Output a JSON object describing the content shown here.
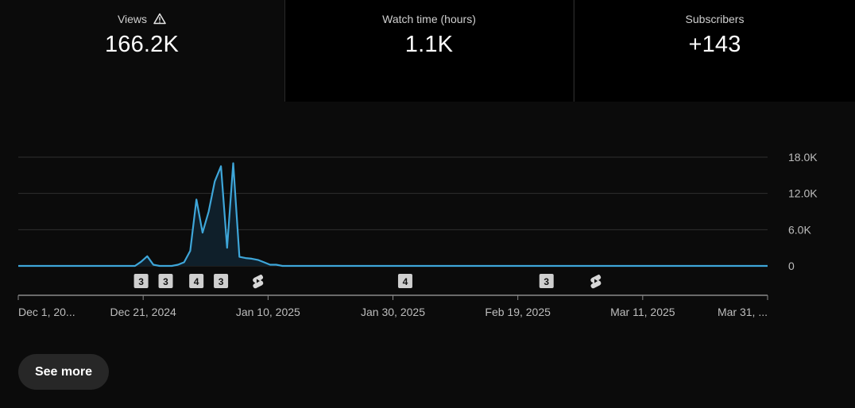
{
  "metrics": [
    {
      "label": "Views",
      "value": "166.2K",
      "warning_icon": "warning-triangle-icon"
    },
    {
      "label": "Watch time (hours)",
      "value": "1.1K"
    },
    {
      "label": "Subscribers",
      "value": "+143"
    }
  ],
  "chart_data": {
    "type": "area",
    "series": [
      {
        "values": [
          0,
          0,
          0,
          0,
          0,
          0,
          0,
          0,
          0,
          0,
          0,
          0,
          0,
          0,
          0,
          0,
          0,
          0,
          0,
          0,
          700,
          1600,
          200,
          0,
          0,
          0,
          200,
          600,
          2500,
          11000,
          5500,
          9000,
          14000,
          16500,
          3000,
          17000,
          1500,
          1300,
          1200,
          1000,
          600,
          200,
          200,
          0,
          0,
          0,
          0,
          0,
          0,
          0,
          0,
          0,
          0,
          0,
          0,
          0,
          0,
          0,
          0,
          0,
          0,
          0,
          0,
          0,
          0,
          0,
          0,
          0,
          0,
          0,
          0,
          0,
          0,
          0,
          0,
          0,
          0,
          0,
          0,
          0,
          0,
          0,
          0,
          0,
          0,
          0,
          0,
          0,
          0,
          0,
          0,
          0,
          0,
          0,
          0,
          0,
          0,
          0,
          0,
          0,
          0,
          0,
          0,
          0,
          0,
          0,
          0,
          0,
          0,
          0,
          0,
          0,
          0,
          0,
          0,
          0,
          0,
          0,
          0,
          0,
          0,
          0,
          0
        ]
      }
    ],
    "x_tick_labels": [
      "Dec 1, 20...",
      "Dec 21, 2024",
      "Jan 10, 2025",
      "Jan 30, 2025",
      "Feb 19, 2025",
      "Mar 11, 2025",
      "Mar 31, ..."
    ],
    "y_tick_labels": [
      "18.0K",
      "12.0K",
      "6.0K",
      "0"
    ],
    "y_ticks": [
      18000,
      12000,
      6000,
      0
    ],
    "ylim": [
      0,
      18000
    ],
    "grid": true,
    "line_color": "#3ea6d9",
    "markers": [
      {
        "type": "count",
        "label": "3",
        "index": 20
      },
      {
        "type": "count",
        "label": "3",
        "index": 24
      },
      {
        "type": "count",
        "label": "4",
        "index": 29
      },
      {
        "type": "count",
        "label": "3",
        "index": 33
      },
      {
        "type": "shorts",
        "index": 39
      },
      {
        "type": "count",
        "label": "4",
        "index": 63
      },
      {
        "type": "count",
        "label": "3",
        "index": 86
      },
      {
        "type": "shorts",
        "index": 94
      }
    ]
  },
  "see_more_label": "See more"
}
